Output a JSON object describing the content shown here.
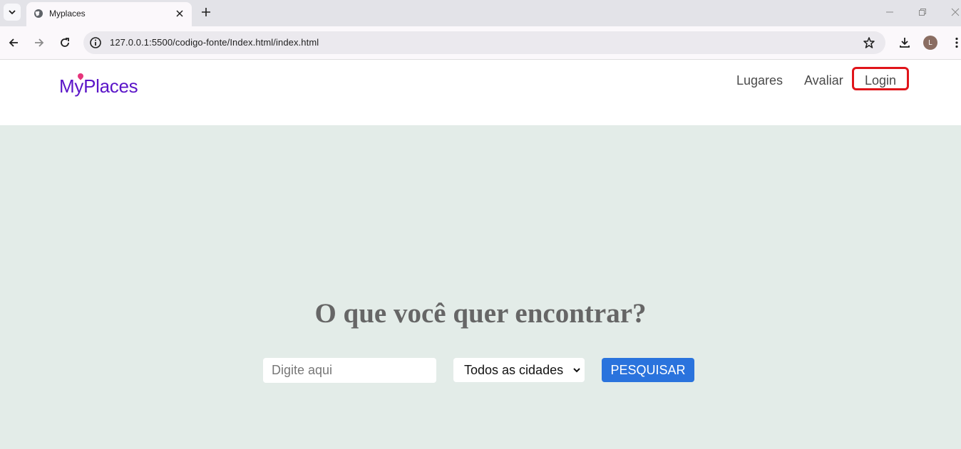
{
  "browser": {
    "tab_title": "Myplaces",
    "url": "127.0.0.1:5500/codigo-fonte/Index.html/index.html",
    "profile_initial": "L",
    "icons": [
      "tab-list-icon",
      "globe-icon",
      "close-icon",
      "plus-icon",
      "minimize-icon",
      "restore-icon",
      "window-close-icon",
      "back-icon",
      "forward-icon",
      "reload-icon",
      "site-info-icon",
      "star-icon",
      "download-icon",
      "menu-icon"
    ]
  },
  "header": {
    "logo_part1": "M",
    "logo_part2": "y",
    "logo_part3": "Places",
    "nav": {
      "lugares": "Lugares",
      "avaliar": "Avaliar",
      "login": "Login"
    },
    "highlight_color": "#e0141a"
  },
  "hero": {
    "title": "O que você quer encontrar?",
    "search_placeholder": "Digite aqui",
    "city_selected": "Todos as cidades",
    "search_button": "PESQUISAR"
  },
  "colors": {
    "page_bg": "#e3ece8",
    "logo": "#5b15c8",
    "button": "#2a73dd"
  }
}
